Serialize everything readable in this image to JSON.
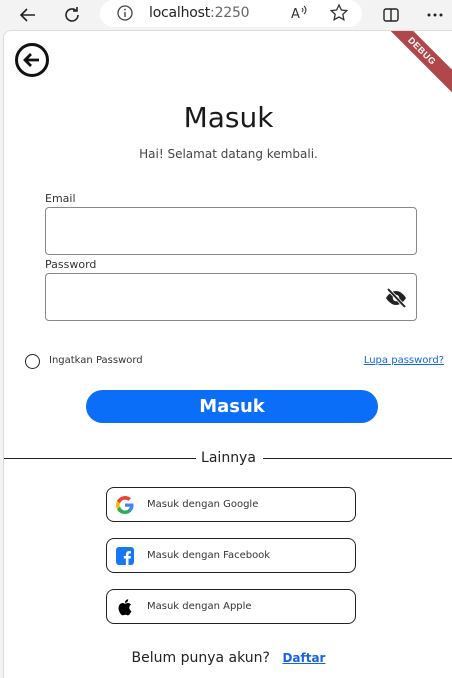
{
  "browser": {
    "url_host": "localhost",
    "url_port": ":2250"
  },
  "debug_banner": "DEBUG",
  "header": {
    "title": "Masuk",
    "subtitle": "Hai! Selamat datang kembali."
  },
  "form": {
    "email_label": "Email",
    "email_value": "",
    "password_label": "Password",
    "password_value": "",
    "remember_label": "Ingatkan Password",
    "forgot_label": "Lupa password?",
    "submit_label": "Masuk"
  },
  "divider_label": "Lainnya",
  "social": [
    {
      "label": "Masuk dengan Google",
      "icon": "google-icon"
    },
    {
      "label": "Masuk dengan Facebook",
      "icon": "facebook-icon"
    },
    {
      "label": "Masuk dengan Apple",
      "icon": "apple-icon"
    }
  ],
  "footer": {
    "prompt": "Belum punya akun?",
    "link": "Daftar"
  },
  "colors": {
    "primary": "#0a6ef8",
    "link": "#1565e0",
    "debug": "#b0474a"
  }
}
